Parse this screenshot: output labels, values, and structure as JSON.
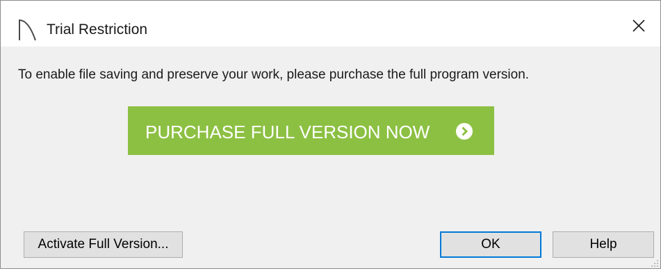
{
  "window": {
    "title": "Trial Restriction",
    "app_icon": "arch-logo-icon",
    "close_icon": "close-icon"
  },
  "message": "To enable file saving and preserve your work, please purchase the full program version.",
  "purchase": {
    "label": "PURCHASE FULL VERSION NOW",
    "icon": "chevron-right-circle-icon",
    "color": "#8cc043"
  },
  "buttons": {
    "activate_label": "Activate Full Version...",
    "ok_label": "OK",
    "help_label": "Help"
  },
  "colors": {
    "focus_border": "#0078d7",
    "dialog_bg": "#f0f0f0"
  }
}
